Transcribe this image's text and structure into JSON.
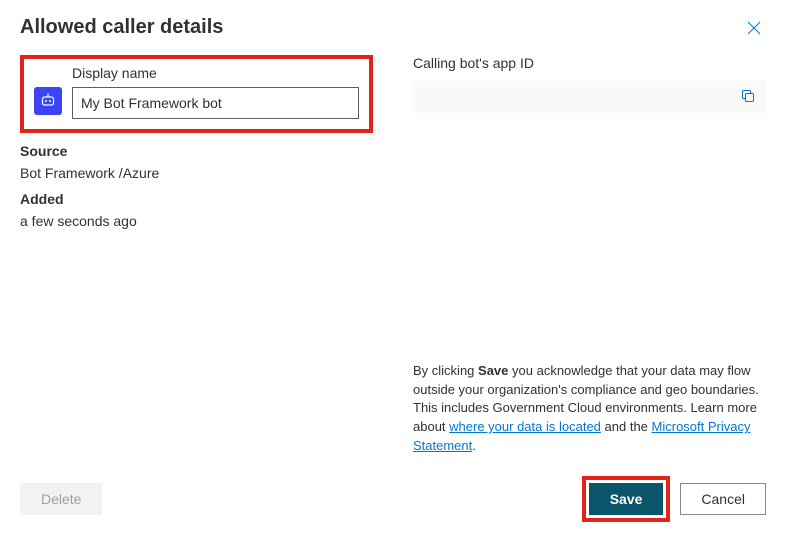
{
  "panel": {
    "title": "Allowed caller details"
  },
  "displayName": {
    "label": "Display name",
    "value": "My Bot Framework bot"
  },
  "source": {
    "label": "Source",
    "value": "Bot Framework /Azure"
  },
  "added": {
    "label": "Added",
    "value": "a few seconds ago"
  },
  "appId": {
    "label": "Calling bot's app ID",
    "value": ""
  },
  "legal": {
    "prefix": "By clicking ",
    "saveWord": "Save",
    "middle": " you acknowledge that your data may flow outside your organization's compliance and geo boundaries. This includes Government Cloud environments. Learn more about ",
    "link1": "where your data is located",
    "and": " and the ",
    "link2": "Microsoft Privacy Statement",
    "period": "."
  },
  "buttons": {
    "delete": "Delete",
    "save": "Save",
    "cancel": "Cancel"
  }
}
